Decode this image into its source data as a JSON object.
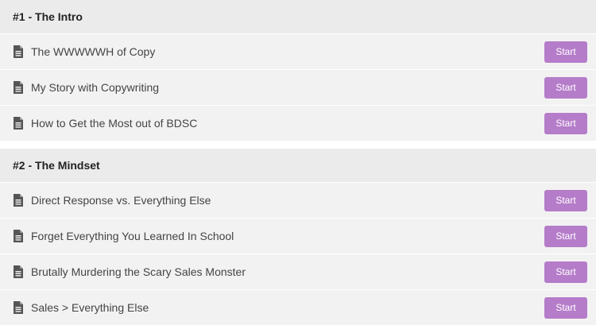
{
  "sections": [
    {
      "title": "#1 - The Intro",
      "lectures": [
        {
          "title": "The WWWWWH of Copy",
          "button": "Start",
          "icon": "document-icon"
        },
        {
          "title": "My Story with Copywriting",
          "button": "Start",
          "icon": "document-icon"
        },
        {
          "title": "How to Get the Most out of BDSC",
          "button": "Start",
          "icon": "document-icon"
        }
      ]
    },
    {
      "title": "#2 - The Mindset",
      "lectures": [
        {
          "title": "Direct Response vs. Everything Else",
          "button": "Start",
          "icon": "document-icon"
        },
        {
          "title": "Forget Everything You Learned In School",
          "button": "Start",
          "icon": "document-icon"
        },
        {
          "title": "Brutally Murdering the Scary Sales Monster",
          "button": "Start",
          "icon": "document-icon"
        },
        {
          "title": "Sales > Everything Else",
          "button": "Start",
          "icon": "document-icon"
        }
      ]
    }
  ],
  "colors": {
    "accent": "#b57cc9",
    "header_bg": "#ebebeb",
    "row_bg": "#f2f2f2"
  }
}
